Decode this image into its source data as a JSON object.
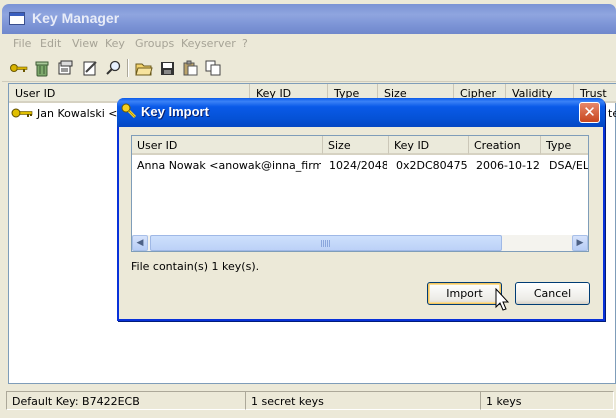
{
  "main_window": {
    "title": "Key Manager",
    "menu": [
      "File",
      "Edit",
      "View",
      "Key",
      "Groups",
      "Keyserver",
      "?"
    ],
    "toolbar_icons": [
      "key-icon",
      "trash-icon",
      "properties-icon",
      "sign-icon",
      "search-icon",
      "open-folder-icon",
      "save-icon",
      "paste-icon",
      "copy-icon"
    ],
    "columns": [
      "User ID",
      "Key ID",
      "Type",
      "Size",
      "Cipher",
      "Validity",
      "Trust"
    ],
    "row_user_id": "Jan Kowalski <jk",
    "row_trailing": "te",
    "status": {
      "default_key": "Default Key: B7422ECB",
      "secret_keys": "1 secret keys",
      "keys": "1 keys"
    }
  },
  "dialog": {
    "title": "Key Import",
    "columns": [
      "User ID",
      "Size",
      "Key ID",
      "Creation",
      "Type"
    ],
    "rows": [
      {
        "user_id": "Anna Nowak <anowak@inna_firma....",
        "size": "1024/2048",
        "key_id": "0x2DC80475",
        "creation": "2006-10-12",
        "type": "DSA/EL"
      }
    ],
    "info": "File contain(s) 1 key(s).",
    "import_label": "Import",
    "cancel_label": "Cancel",
    "close_label": "✕"
  },
  "colors": {
    "desktop": "#f2cf00",
    "active_title": "#0a5ae8",
    "inactive_title": "#7b93d4"
  }
}
